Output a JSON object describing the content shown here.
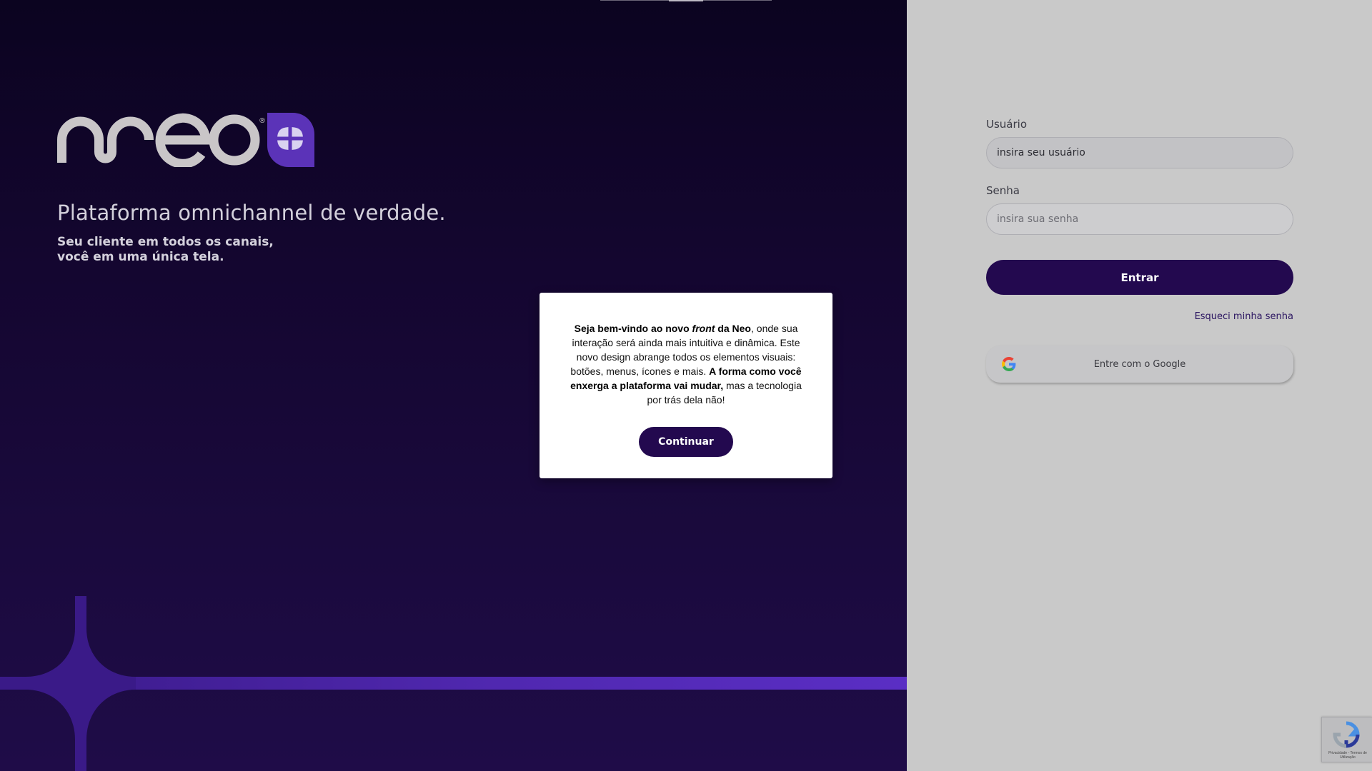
{
  "brand": {
    "logo_text": "neo",
    "registered_mark": "®"
  },
  "hero": {
    "title": "Plataforma omnichannel de verdade.",
    "subtitle_line1": "Seu cliente em todos os canais,",
    "subtitle_line2": "você em uma única tela."
  },
  "login": {
    "username_label": "Usuário",
    "username_value": "insira seu usuário",
    "password_label": "Senha",
    "password_placeholder": "insira sua senha",
    "submit_label": "Entrar",
    "forgot_label": "Esqueci minha senha",
    "google_label": "Entre com o Google"
  },
  "modal": {
    "part1_bold": "Seja bem-vindo ao novo ",
    "part1_italic": "front",
    "part1_bold2": " da Neo",
    "part2": ", onde sua interação será ainda mais intuitiva e dinâmica. Este novo design abrange todos os elementos visuais: botões, menus, ícones e mais. ",
    "part3_bold": "A forma como você enxerga a plataforma vai mudar,",
    "part4": " mas a tecnologia por trás dela não!",
    "continue_label": "Continuar"
  },
  "recaptcha": {
    "footer": "Privacidade - Termos de Utilização"
  },
  "colors": {
    "hero_bg": "#140630",
    "accent": "#23094f",
    "logo_badge": "#5b33b8",
    "panel_bg": "#c9c9c9"
  }
}
